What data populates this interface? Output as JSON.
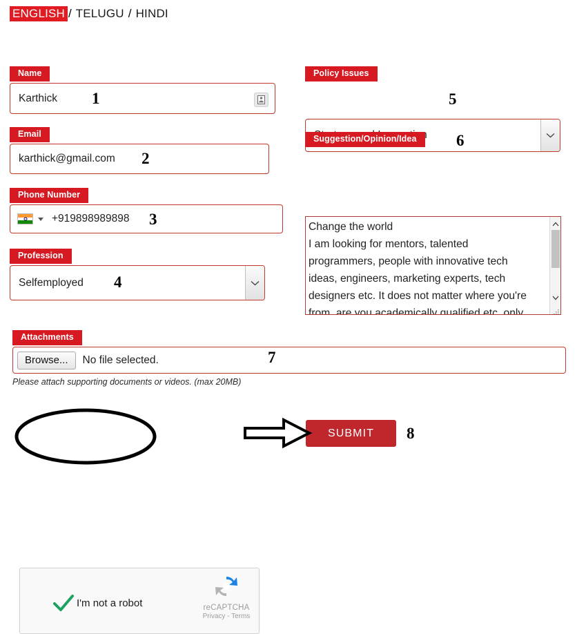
{
  "language_bar": {
    "active": "ENGLISH",
    "separator": "/",
    "others": [
      "TELUGU",
      "HINDI"
    ],
    "full_text": "ENGLISH / TELUGU / HINDI",
    "active_bg": "#e01b22"
  },
  "theme": {
    "tag_red": "#d71921",
    "border_red": "#c0392b",
    "submit_red": "#c0272d"
  },
  "form": {
    "name": {
      "label": "Name",
      "value": "Karthick",
      "placeholder": "Name",
      "icon": "contact-card-icon",
      "annotation": "1"
    },
    "email": {
      "label": "Email",
      "value": "karthick@gmail.com",
      "placeholder": "Email",
      "annotation": "2"
    },
    "phone": {
      "label": "Phone Number",
      "value": "+919898989898",
      "placeholder": "Phone Number",
      "country_flag": "india-flag-icon",
      "annotation": "3"
    },
    "profession": {
      "label": "Profession",
      "value": "Selfemployed",
      "annotation": "4"
    },
    "policy_issues": {
      "label": "Policy Issues",
      "value": "Startups and Innovation",
      "annotation": "5"
    },
    "suggestion": {
      "label": "Suggestion/Opinion/Idea",
      "value": "Change the world\nI am looking for mentors, talented programmers, people with innovative tech ideas, engineers, marketing experts, tech designers etc. It does not matter where you're from, are you academically qualified etc. only thing that matters is your personality, creativity",
      "annotation": "6"
    },
    "attachments": {
      "label": "Attachments",
      "browse_label": "Browse...",
      "file_status": "No file selected.",
      "hint": "Please attach supporting documents or videos. (max 20MB)",
      "annotation": "7"
    }
  },
  "recaptcha": {
    "checkbox_label": "I'm not a robot",
    "brand": "reCAPTCHA",
    "legal": "Privacy - Terms",
    "checked": true
  },
  "submit": {
    "label": "SUBMIT",
    "annotation": "8"
  }
}
